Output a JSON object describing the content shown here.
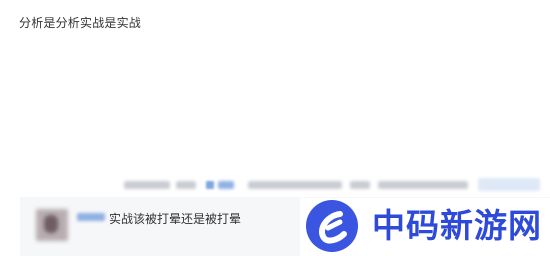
{
  "post": {
    "text": "分析是分析实战是实战"
  },
  "reply": {
    "comment": "实战该被打晕还是被打晕"
  },
  "watermark": {
    "text": "中码新游网"
  },
  "colors": {
    "text": "#333333",
    "link_blur": "#8fb1e3",
    "meta_blur": "#c9cdd3",
    "reply_bg": "#f6f7f9",
    "watermark_blue": "#2e4ad9"
  },
  "icons": {
    "watermark_logo": "c-logo-icon"
  }
}
